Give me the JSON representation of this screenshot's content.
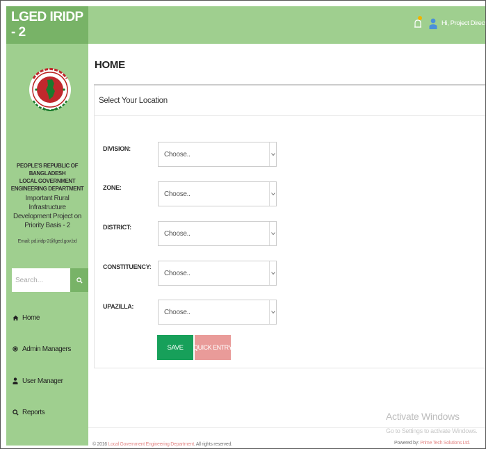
{
  "brand": {
    "title": "LGED IRIDP - 2"
  },
  "sidebar": {
    "org_lines": [
      "PEOPLE'S REPUBLIC OF BANGLADESH",
      "LOCAL GOVERNMENT",
      "ENGINEERING DEPARTMENT"
    ],
    "project_lines": [
      "Important Rural Infrastructure",
      "Development Project on",
      "Priority Basis - 2"
    ],
    "email": "Email: pd.iridp-2@lged.gov.bd",
    "search": {
      "placeholder": "Search..."
    },
    "nav": [
      {
        "label": "Home",
        "icon": "home-icon"
      },
      {
        "label": "Admin Managers",
        "icon": "radio-dot-icon"
      },
      {
        "label": "User Manager",
        "icon": "user-icon"
      },
      {
        "label": "Reports",
        "icon": "search-icon"
      }
    ]
  },
  "header": {
    "user_label": "Hi, Project Director"
  },
  "main": {
    "title": "HOME",
    "panel_title": "Select Your Location",
    "fields": [
      {
        "label": "DIVISION:",
        "value": "Choose.."
      },
      {
        "label": "ZONE:",
        "value": "Choose.."
      },
      {
        "label": "DISTRICT:",
        "value": "Choose.."
      },
      {
        "label": "CONSTITUENCY:",
        "value": "Choose.."
      },
      {
        "label": "UPAZILLA:",
        "value": "Choose.."
      }
    ],
    "save_label": "SAVE",
    "quick_entry_label": "QUICK ENTRY"
  },
  "watermark": {
    "line1": "Activate Windows",
    "line2": "Go to Settings to activate Windows."
  },
  "footer": {
    "copyright_prefix": "© 2016",
    "copyright_link": "Local Government Engineering Department",
    "copyright_suffix": ". All rights reserved.",
    "powered_prefix": "Powered by:",
    "powered_link": "Prime Tech Solutions Ltd."
  },
  "colors": {
    "sidebar_bg": "#9fcf8f",
    "brand_bg": "#78b367",
    "save_button": "#17a05a",
    "quick_entry_button": "#e99b99"
  }
}
